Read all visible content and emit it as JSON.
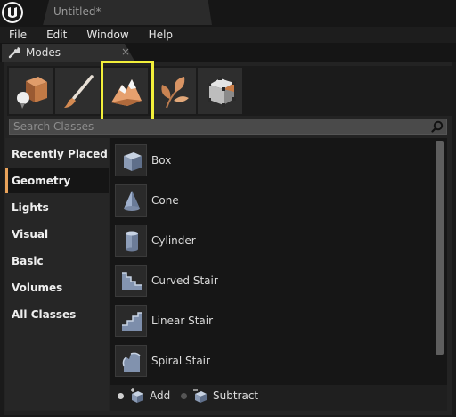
{
  "window": {
    "doc_tab": "Untitled*"
  },
  "menu": [
    "File",
    "Edit",
    "Window",
    "Help"
  ],
  "modes_tab": {
    "label": "Modes",
    "close": "×"
  },
  "tools": [
    {
      "name": "place-tool",
      "icon": "place-icon"
    },
    {
      "name": "paint-tool",
      "icon": "paintbrush-icon"
    },
    {
      "name": "landscape-tool",
      "icon": "landscape-icon",
      "highlighted": true
    },
    {
      "name": "foliage-tool",
      "icon": "foliage-icon"
    },
    {
      "name": "geometry-edit-tool",
      "icon": "geometry-cube-icon"
    }
  ],
  "search": {
    "placeholder": "Search Classes",
    "value": ""
  },
  "categories": [
    "Recently Placed",
    "Geometry",
    "Lights",
    "Visual",
    "Basic",
    "Volumes",
    "All Classes"
  ],
  "active_category": "Geometry",
  "items": [
    {
      "label": "Box",
      "icon": "box-icon"
    },
    {
      "label": "Cone",
      "icon": "cone-icon"
    },
    {
      "label": "Cylinder",
      "icon": "cylinder-icon"
    },
    {
      "label": "Curved Stair",
      "icon": "curved-stair-icon"
    },
    {
      "label": "Linear Stair",
      "icon": "linear-stair-icon"
    },
    {
      "label": "Spiral Stair",
      "icon": "spiral-stair-icon"
    }
  ],
  "footer": {
    "add_label": "Add",
    "subtract_label": "Subtract",
    "selected": "Add"
  },
  "colors": {
    "highlight": "#f2ef3a",
    "active_category_accent": "#e8a25a"
  }
}
